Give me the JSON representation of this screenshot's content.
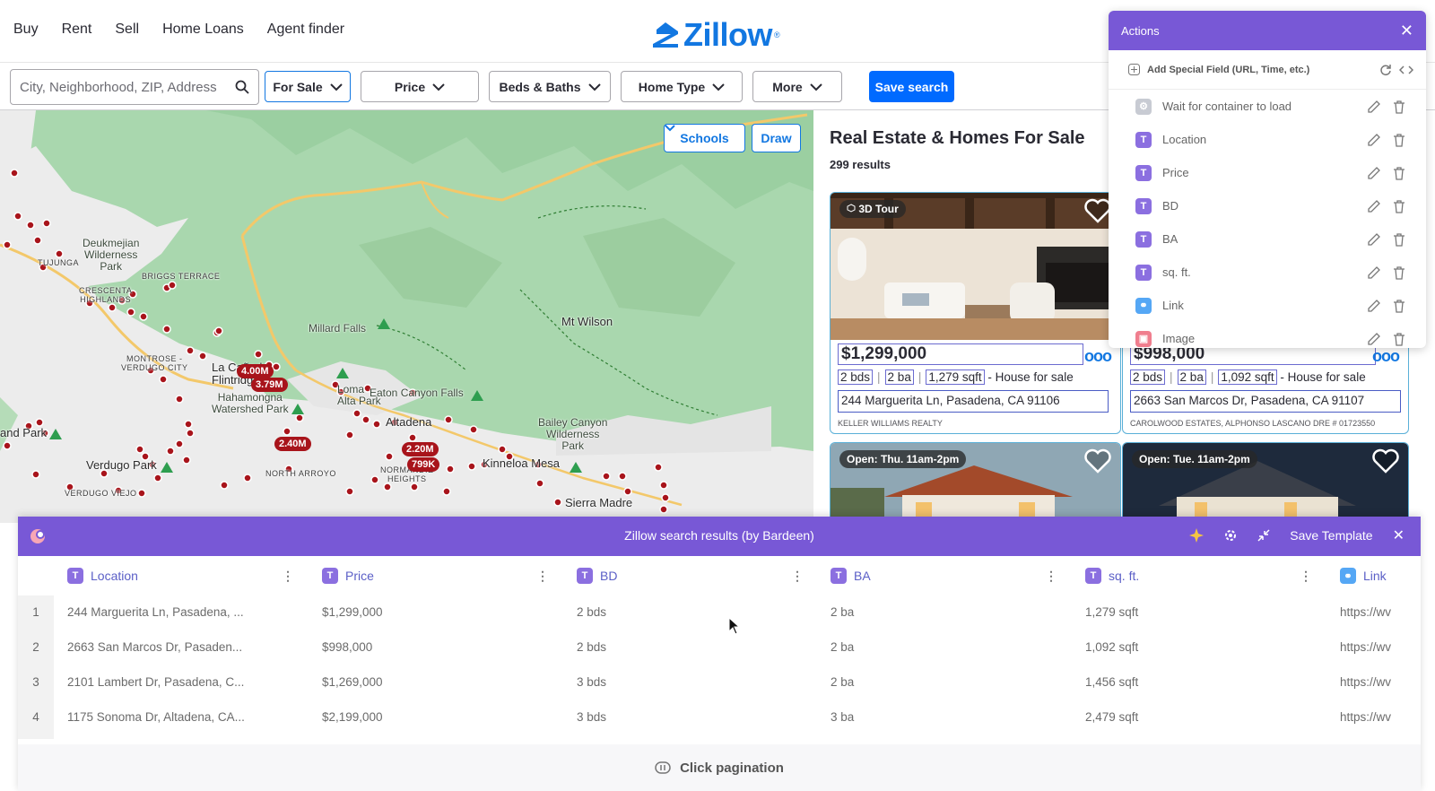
{
  "nav": {
    "links": [
      "Buy",
      "Rent",
      "Sell",
      "Home Loans",
      "Agent finder"
    ],
    "logo_text": "Zillow",
    "brand_color": "#1277e1"
  },
  "filters": {
    "search_placeholder": "City, Neighborhood, ZIP, Address",
    "for_sale": "For Sale",
    "price": "Price",
    "beds_baths": "Beds & Baths",
    "home_type": "Home Type",
    "more": "More",
    "save_search": "Save search"
  },
  "map": {
    "schools": "Schools",
    "draw": "Draw",
    "places": {
      "deukmejian": "Deukmejian\nWilderness\nPark",
      "briggs": "BRIGGS TERRACE",
      "crescenta": "CRESCENTA\nHIGHLANDS",
      "tujunga": "TUJUNGA",
      "millard": "Millard Falls",
      "mtwilson": "Mt Wilson",
      "montrose": "MONTROSE -\nVERDUGO CITY",
      "lacanada": "La Cañada\nFlintridge",
      "hahamonga": "Hahamongna\nWatershed Park",
      "eaton": "Eaton Canyon Falls",
      "altadena": "Altadena",
      "loma": "Loma\nAlta Park",
      "bailey": "Bailey Canyon\nWilderness\nPark",
      "kinneloa": "Kinneloa Mesa",
      "oakpark": "and Park",
      "verdugo": "Verdugo Park",
      "northarroyo": "NORTH ARROYO",
      "normandie": "NORMANDIE\nHEIGHTS",
      "verdugoviejo": "VERDUGO VIEJO",
      "sierramadre": "Sierra Madre"
    },
    "price_pins": [
      "4.00M",
      "3.79M",
      "2.40M",
      "2.20M",
      "799K"
    ]
  },
  "listings": {
    "title": "Real Estate & Homes For Sale",
    "count": "299 results",
    "cards": [
      {
        "tag": "3D Tour",
        "price": "$1,299,000",
        "bds": "2 bds",
        "ba": "2 ba",
        "sqft": "1,279 sqft",
        "type": "- House for sale",
        "address": "244 Marguerita Ln, Pasadena, CA 91106",
        "broker": "KELLER WILLIAMS REALTY"
      },
      {
        "tag": "",
        "price": "$998,000",
        "bds": "2 bds",
        "ba": "2 ba",
        "sqft": "1,092 sqft",
        "type": "- House for sale",
        "address": "2663 San Marcos Dr, Pasadena, CA 91107",
        "broker": "CAROLWOOD ESTATES, Alphonso Lascano DRE # 01723550"
      },
      {
        "tag": "Open: Thu. 11am-2pm"
      },
      {
        "tag": "Open: Tue. 11am-2pm"
      }
    ]
  },
  "actions": {
    "title": "Actions",
    "add_field": "Add Special Field (URL, Time, etc.)",
    "items": [
      {
        "label": "Wait for container to load",
        "badge": "⚙"
      },
      {
        "label": "Location",
        "badge": "T"
      },
      {
        "label": "Price",
        "badge": "T"
      },
      {
        "label": "BD",
        "badge": "T"
      },
      {
        "label": "BA",
        "badge": "T"
      },
      {
        "label": "sq. ft.",
        "badge": "T"
      },
      {
        "label": "Link",
        "badge": "⚭"
      },
      {
        "label": "Image",
        "badge": "▣"
      }
    ],
    "accent": "#7858d6"
  },
  "results": {
    "title": "Zillow search results (by Bardeen)",
    "save_template": "Save Template",
    "columns": [
      "Location",
      "Price",
      "BD",
      "BA",
      "sq. ft.",
      "Link"
    ],
    "rows": [
      [
        "1",
        "244 Marguerita Ln, Pasadena, ...",
        "$1,299,000",
        "2 bds",
        "2 ba",
        "1,279 sqft",
        "https://wv"
      ],
      [
        "2",
        "2663 San Marcos Dr, Pasaden...",
        "$998,000",
        "2 bds",
        "2 ba",
        "1,092 sqft",
        "https://wv"
      ],
      [
        "3",
        "2101 Lambert Dr, Pasadena, C...",
        "$1,269,000",
        "3 bds",
        "2 ba",
        "1,456 sqft",
        "https://wv"
      ],
      [
        "4",
        "1175 Sonoma Dr, Altadena, CA...",
        "$2,199,000",
        "3 bds",
        "3 ba",
        "2,479 sqft",
        "https://wv"
      ]
    ],
    "pagination": "Click pagination"
  }
}
